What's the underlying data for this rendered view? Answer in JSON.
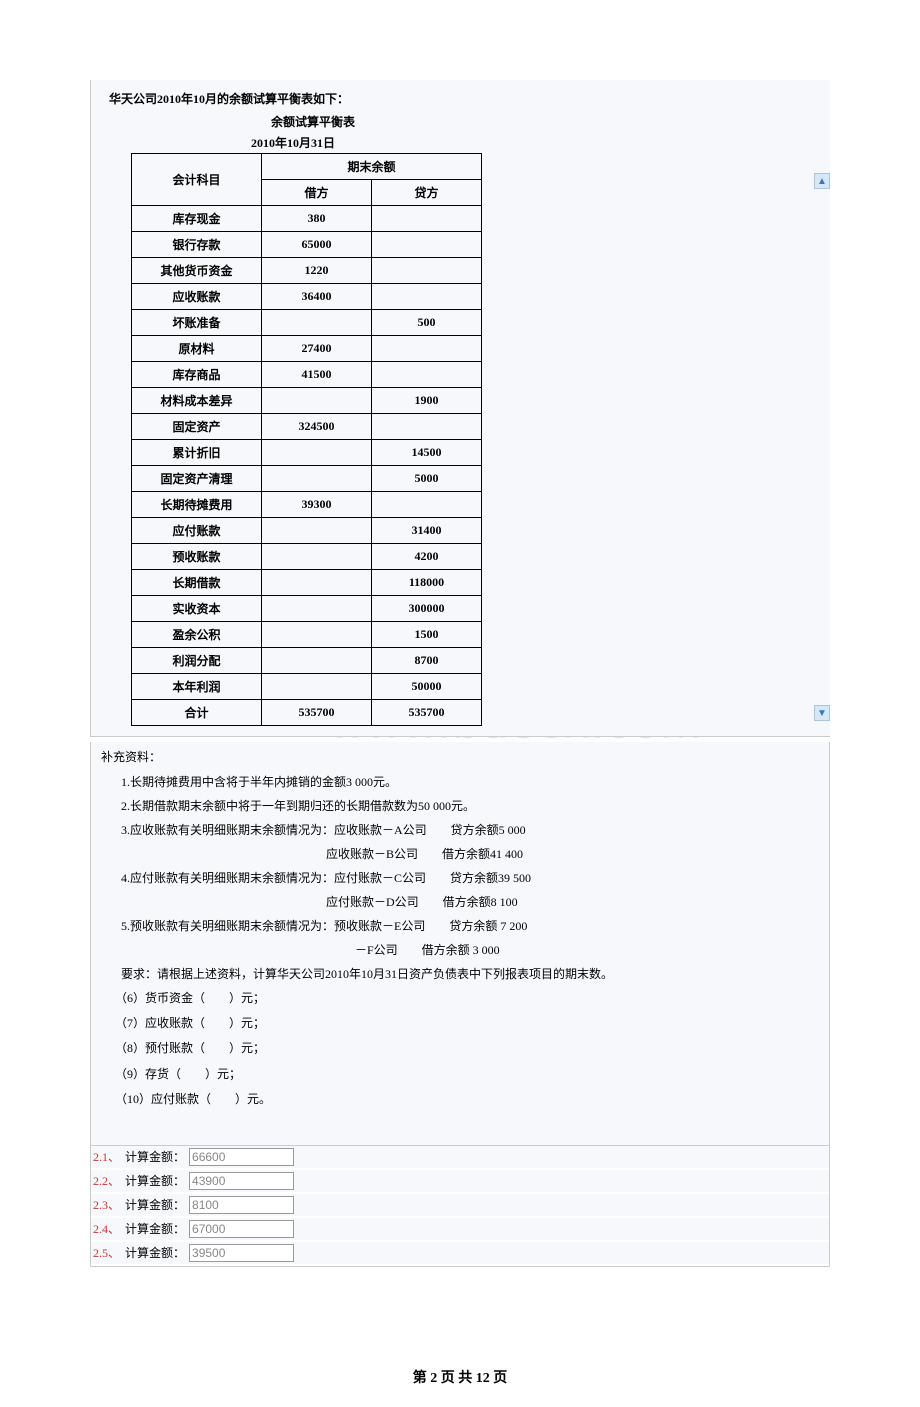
{
  "header": {
    "title_line": "华天公司2010年10月的余额试算平衡表如下：",
    "table_title": "余额试算平衡表",
    "table_date": "2010年10月31日"
  },
  "table_headers": {
    "subject": "会计科目",
    "balance_group": "期末余额",
    "debit": "借方",
    "credit": "贷方"
  },
  "rows": [
    {
      "subject": "库存现金",
      "debit": "380",
      "credit": ""
    },
    {
      "subject": "银行存款",
      "debit": "65000",
      "credit": ""
    },
    {
      "subject": "其他货币资金",
      "debit": "1220",
      "credit": ""
    },
    {
      "subject": "应收账款",
      "debit": "36400",
      "credit": ""
    },
    {
      "subject": "坏账准备",
      "debit": "",
      "credit": "500"
    },
    {
      "subject": "原材料",
      "debit": "27400",
      "credit": ""
    },
    {
      "subject": "库存商品",
      "debit": "41500",
      "credit": ""
    },
    {
      "subject": "材料成本差异",
      "debit": "",
      "credit": "1900"
    },
    {
      "subject": "固定资产",
      "debit": "324500",
      "credit": ""
    },
    {
      "subject": "累计折旧",
      "debit": "",
      "credit": "14500"
    },
    {
      "subject": "固定资产清理",
      "debit": "",
      "credit": "5000"
    },
    {
      "subject": "长期待摊费用",
      "debit": "39300",
      "credit": ""
    },
    {
      "subject": "应付账款",
      "debit": "",
      "credit": "31400"
    },
    {
      "subject": "预收账款",
      "debit": "",
      "credit": "4200"
    },
    {
      "subject": "长期借款",
      "debit": "",
      "credit": "118000"
    },
    {
      "subject": "实收资本",
      "debit": "",
      "credit": "300000"
    },
    {
      "subject": "盈余公积",
      "debit": "",
      "credit": "1500"
    },
    {
      "subject": "利润分配",
      "debit": "",
      "credit": "8700"
    },
    {
      "subject": "本年利润",
      "debit": "",
      "credit": "50000"
    },
    {
      "subject": "合计",
      "debit": "535700",
      "credit": "535700"
    }
  ],
  "supplement": {
    "heading": "补充资料：",
    "items": [
      "1.长期待摊费用中含将于半年内摊销的金额3 000元。",
      "2.长期借款期末余额中将于一年到期归还的长期借款数为50 000元。",
      "3.应收账款有关明细账期末余额情况为：应收账款－A公司　　贷方余额5 000",
      "应收账款－B公司　　借方余额41 400",
      "4.应付账款有关明细账期末余额情况为：应付账款－C公司　　贷方余额39 500",
      "应付账款－D公司　　借方余额8 100",
      "5.预收账款有关明细账期末余额情况为：预收账款－E公司　　贷方余额 7 200",
      "－F公司　　借方余额 3 000",
      "要求：请根据上述资料，计算华天公司2010年10月31日资产负债表中下列报表项目的期末数。"
    ],
    "questions": [
      "（6）货币资金（　　）元；",
      "（7）应收账款（　　）元；",
      "（8）预付账款（　　）元；",
      "（9）存货（　　）元；",
      "（10）应付账款（　　）元。"
    ]
  },
  "answers_label": "计算金额：",
  "answers": [
    {
      "num": "2.1、",
      "value": "66600"
    },
    {
      "num": "2.2、",
      "value": "43900"
    },
    {
      "num": "2.3、",
      "value": "8100"
    },
    {
      "num": "2.4、",
      "value": "67000"
    },
    {
      "num": "2.5、",
      "value": "39500"
    }
  ],
  "watermark": "www.bdocx.com",
  "footer": "第 2 页 共 12 页",
  "chart_data": {
    "type": "table",
    "title": "余额试算平衡表 2010年10月31日",
    "columns": [
      "会计科目",
      "借方",
      "贷方"
    ],
    "data": [
      [
        "库存现金",
        380,
        null
      ],
      [
        "银行存款",
        65000,
        null
      ],
      [
        "其他货币资金",
        1220,
        null
      ],
      [
        "应收账款",
        36400,
        null
      ],
      [
        "坏账准备",
        null,
        500
      ],
      [
        "原材料",
        27400,
        null
      ],
      [
        "库存商品",
        41500,
        null
      ],
      [
        "材料成本差异",
        null,
        1900
      ],
      [
        "固定资产",
        324500,
        null
      ],
      [
        "累计折旧",
        null,
        14500
      ],
      [
        "固定资产清理",
        null,
        5000
      ],
      [
        "长期待摊费用",
        39300,
        null
      ],
      [
        "应付账款",
        null,
        31400
      ],
      [
        "预收账款",
        null,
        4200
      ],
      [
        "长期借款",
        null,
        118000
      ],
      [
        "实收资本",
        null,
        300000
      ],
      [
        "盈余公积",
        null,
        1500
      ],
      [
        "利润分配",
        null,
        8700
      ],
      [
        "本年利润",
        null,
        50000
      ],
      [
        "合计",
        535700,
        535700
      ]
    ]
  }
}
